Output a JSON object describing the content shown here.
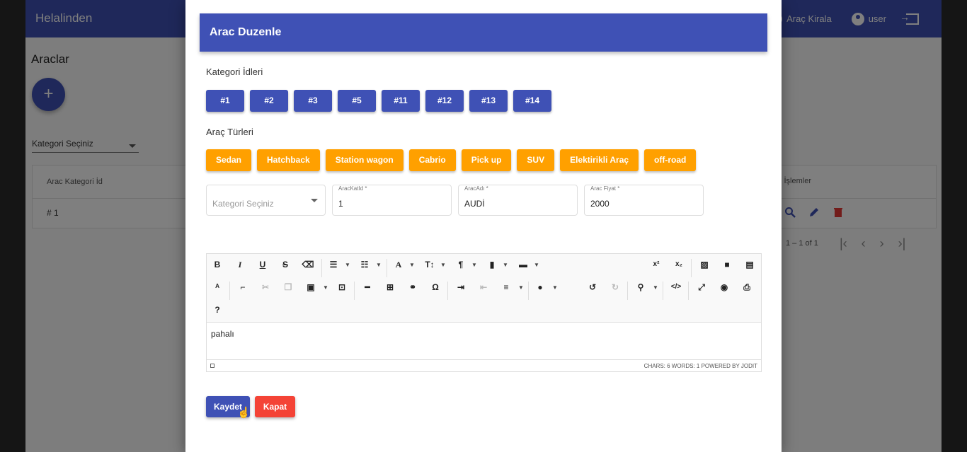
{
  "app": {
    "brand": "Helalinden",
    "nav": {
      "rent_label": "Araç Kirala",
      "user_label": "user"
    },
    "page_title": "Araclar",
    "fab_label": "+",
    "category_select": "Kategori Seçiniz",
    "table": {
      "col1": "Arac Kategori İd",
      "col_actions": "İşlemler",
      "row1": "# 1"
    },
    "pager": {
      "range": "1 – 1 of 1"
    }
  },
  "dialog": {
    "title": "Arac Duzenle",
    "category_ids_label": "Kategori İdleri",
    "category_ids": [
      "#1",
      "#2",
      "#3",
      "#5",
      "#11",
      "#12",
      "#13",
      "#14"
    ],
    "vehicle_types_label": "Araç Türleri",
    "vehicle_types": [
      "Sedan",
      "Hatchback",
      "Station wagon",
      "Cabrio",
      "Pick up",
      "SUV",
      "Elektirikli Araç",
      "off-road"
    ],
    "form": {
      "category_placeholder": "Kategori Seçiniz",
      "katid_label": "AracKatId *",
      "katid_value": "1",
      "name_label": "AracAdı *",
      "name_value": "AUDİ",
      "price_label": "Arac Fiyat *",
      "price_value": "2000"
    },
    "editor": {
      "content": "pahalı",
      "stats": "CHARS: 6   WORDS: 1   POWERED BY JODIT"
    },
    "buttons": {
      "save": "Kaydet",
      "close": "Kapat"
    }
  },
  "colors": {
    "primary": "#3f51b5",
    "accent": "#ffa000",
    "danger": "#f44336"
  }
}
